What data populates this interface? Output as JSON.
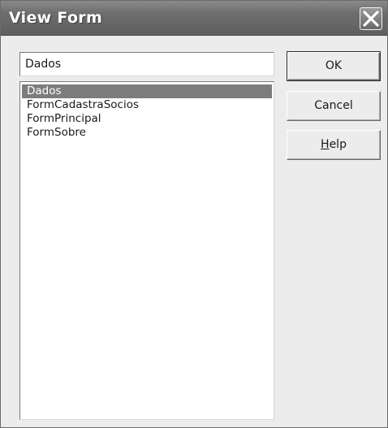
{
  "window": {
    "title": "View Form"
  },
  "icons": {
    "close": "close-icon"
  },
  "form_name": {
    "value": "Dados"
  },
  "form_list": {
    "items": [
      "Dados",
      "FormCadastraSocios",
      "FormPrincipal",
      "FormSobre"
    ],
    "selected": "Dados"
  },
  "buttons": {
    "ok": "OK",
    "cancel": "Cancel",
    "help_mnemonic": "H",
    "help_rest": "elp"
  },
  "colors": {
    "titlebar": "#6e6e6e",
    "selection": "#7c7c7c",
    "dialog_bg": "#ececec"
  }
}
